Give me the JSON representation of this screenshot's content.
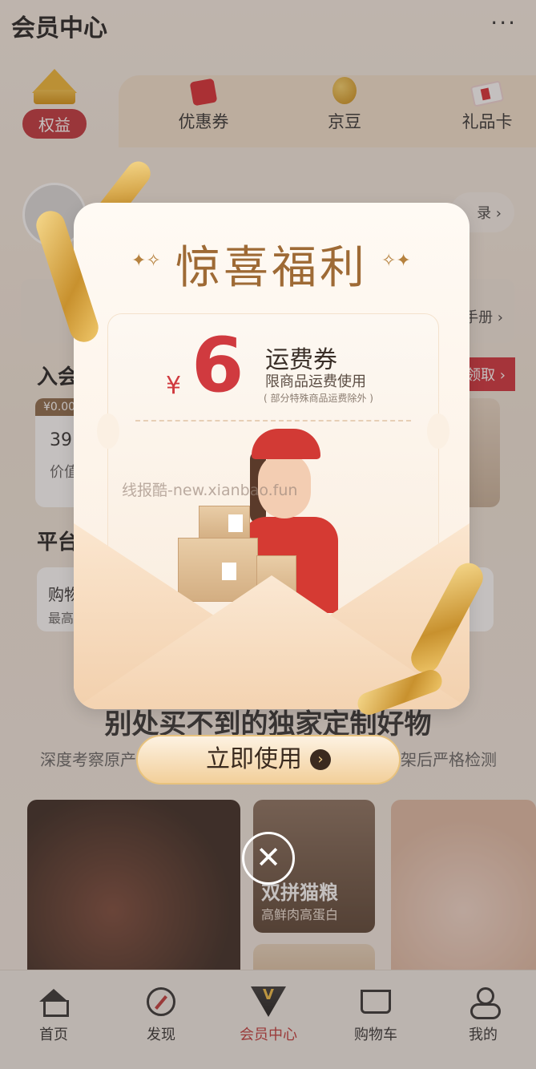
{
  "header": {
    "title": "会员中心",
    "more_icon": "more-dots-icon",
    "more_glyph": "···"
  },
  "top_tabs": [
    {
      "label": "权益",
      "icon": "crown-icon",
      "active": true
    },
    {
      "label": "优惠券",
      "icon": "coupon-icon"
    },
    {
      "label": "京豆",
      "icon": "bean-icon"
    },
    {
      "label": "礼品卡",
      "icon": "gift-card-icon"
    }
  ],
  "profile": {
    "button_suffix": "录 ›"
  },
  "guide": {
    "link": "手册 ›"
  },
  "sections": {
    "join_title": "入会",
    "claim_button": "领取 ›",
    "benefit": {
      "tag": "¥0.00",
      "value": "39",
      "sub": "价值"
    },
    "platform_title": "平台",
    "platform_card": {
      "t1": "购物",
      "t2": "最高"
    }
  },
  "slogan": "别处买不到的独家定制好物",
  "subslogan": {
    "left": "深度考察原产",
    "right": "架后严格检测"
  },
  "tiles": [
    {
      "name": "双拼猫粮",
      "desc": "高鲜肉高蛋白"
    }
  ],
  "bottom_tabs": [
    {
      "label": "首页",
      "icon": "home-icon"
    },
    {
      "label": "发现",
      "icon": "compass-icon"
    },
    {
      "label": "会员中心",
      "icon": "vip-icon",
      "active": true
    },
    {
      "label": "购物车",
      "icon": "cart-icon"
    },
    {
      "label": "我的",
      "icon": "user-icon"
    }
  ],
  "modal": {
    "title": "惊喜福利",
    "coupon": {
      "currency": "¥",
      "amount": "6",
      "name": "运费券",
      "desc": "限商品运费使用",
      "note": "( 部分特殊商品运费除外 )"
    },
    "watermark": "线报酷-new.xianbao.fun",
    "use_button": "立即使用",
    "use_button_arrow": "›",
    "close_glyph": "✕"
  },
  "colors": {
    "accent": "#d03a3f",
    "gold": "#9e6a35",
    "active_tab": "#c23a3a"
  }
}
